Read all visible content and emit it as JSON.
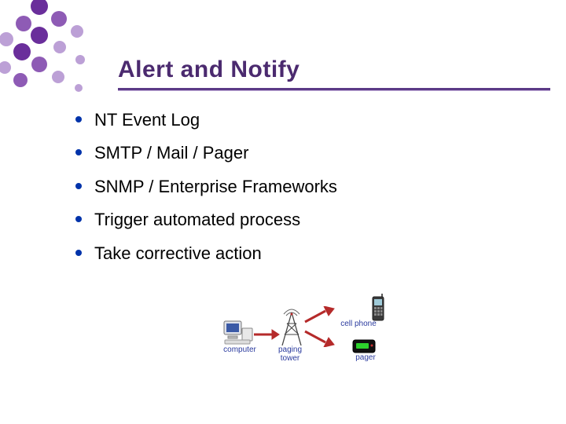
{
  "title": "Alert and Notify",
  "bullets": [
    "NT Event Log",
    "SMTP / Mail / Pager",
    "SNMP / Enterprise Frameworks",
    "Trigger automated process",
    "Take corrective action"
  ],
  "diagram": {
    "labels": {
      "computer": "computer",
      "tower": "paging tower",
      "cell": "cell phone",
      "pager": "pager"
    }
  },
  "colors": {
    "accent": "#4b2a6f",
    "bullet": "#0033aa",
    "arrow": "#b52a2a"
  }
}
